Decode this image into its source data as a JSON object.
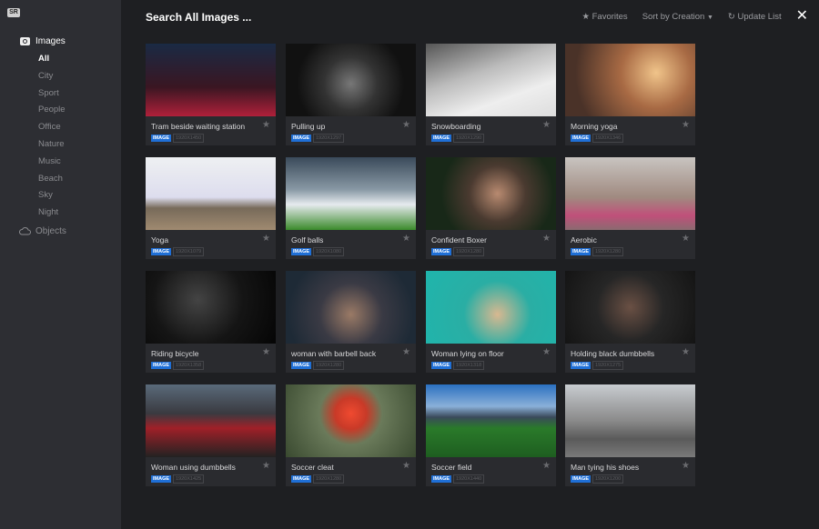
{
  "logo": "SR",
  "sidebar": {
    "section": "Images",
    "items": [
      "All",
      "City",
      "Sport",
      "People",
      "Office",
      "Nature",
      "Music",
      "Beach",
      "Sky",
      "Night"
    ],
    "objects": "Objects"
  },
  "header": {
    "title": "Search All Images ...",
    "favorites": "Favorites",
    "sort": "Sort by Creation",
    "update": "Update List"
  },
  "cards": [
    {
      "title": "Tram beside waiting station",
      "type": "IMAGE",
      "size": "1920X1450",
      "bg": "linear-gradient(180deg,#1a2a44,#3a1622 60%,#b0203a)"
    },
    {
      "title": "Pulling up",
      "type": "IMAGE",
      "size": "1920X1297",
      "bg": "radial-gradient(circle at 50% 55%,#777 0,#333 35%,#111 70%)"
    },
    {
      "title": "Snowboarding",
      "type": "IMAGE",
      "size": "1920X1290",
      "bg": "linear-gradient(160deg,#555 0,#bbb 40%,#eee 70%,#ddd)"
    },
    {
      "title": "Morning yoga",
      "type": "IMAGE",
      "size": "1920X1346",
      "bg": "radial-gradient(circle at 70% 40%,#f0c48a 0,#a86a44 35%,#4a3228 80%)"
    },
    {
      "title": "Yoga",
      "type": "IMAGE",
      "size": "1920X1079",
      "bg": "linear-gradient(180deg,#eef0f2 0,#dde 55%,#776a5a 70%,#a08a70)"
    },
    {
      "title": "Golf balls",
      "type": "IMAGE",
      "size": "1920X1080",
      "bg": "linear-gradient(180deg,#3a4a5a 0,#8a9aa6 45%,#e6eaee 65%,#3a8a2a)"
    },
    {
      "title": "Confident Boxer",
      "type": "IMAGE",
      "size": "1920X1280",
      "bg": "radial-gradient(circle at 55% 50%,#b88a70 0,#4a3a30 35%,#182818 70%)"
    },
    {
      "title": "Aerobic",
      "type": "IMAGE",
      "size": "1920X1280",
      "bg": "linear-gradient(180deg,#c8c4c0 0,#a08a80 55%,#c0507a 80%,#8a6a70)"
    },
    {
      "title": "Riding bicycle",
      "type": "IMAGE",
      "size": "1920X1358",
      "bg": "radial-gradient(circle at 40% 40%,#444 0,#151515 50%,#050505)"
    },
    {
      "title": "woman with barbell back",
      "type": "IMAGE",
      "size": "1920X1280",
      "bg": "radial-gradient(circle at 50% 60%,#9a7a66 0,#3a3a44 40%,#1e2a36 80%)"
    },
    {
      "title": "Woman lying on floor",
      "type": "IMAGE",
      "size": "1920X1318",
      "bg": "radial-gradient(circle at 55% 60%,#d8b890 0,#2aaea4 40%,#1fb5ac)"
    },
    {
      "title": "Holding black dumbbells",
      "type": "IMAGE",
      "size": "1920X1275",
      "bg": "radial-gradient(circle at 50% 50%,#6a5044 0,#262626 45%,#141414)"
    },
    {
      "title": "Woman using dumbbells",
      "type": "IMAGE",
      "size": "1920X1425",
      "bg": "linear-gradient(180deg,#5a6a7a 0,#3a3a40 40%,#a02028 60%,#222)"
    },
    {
      "title": "Soccer cleat",
      "type": "IMAGE",
      "size": "1920X1280",
      "bg": "radial-gradient(circle at 50% 40%,#f04a30 0,#c83a28 20%,#6a7a5a 40%,#3a4a30)"
    },
    {
      "title": "Soccer field",
      "type": "IMAGE",
      "size": "1920X1440",
      "bg": "linear-gradient(180deg,#2a70c0 0,#8ab0d8 30%,#3a4a5a 45%,#2a7a2a 60%,#1e5e20)"
    },
    {
      "title": "Man tying his shoes",
      "type": "IMAGE",
      "size": "1920X1200",
      "bg": "linear-gradient(180deg,#c8ccd0 0,#8a8a8a 50%,#5a5a5a 75%,#7a7a7a)"
    }
  ]
}
